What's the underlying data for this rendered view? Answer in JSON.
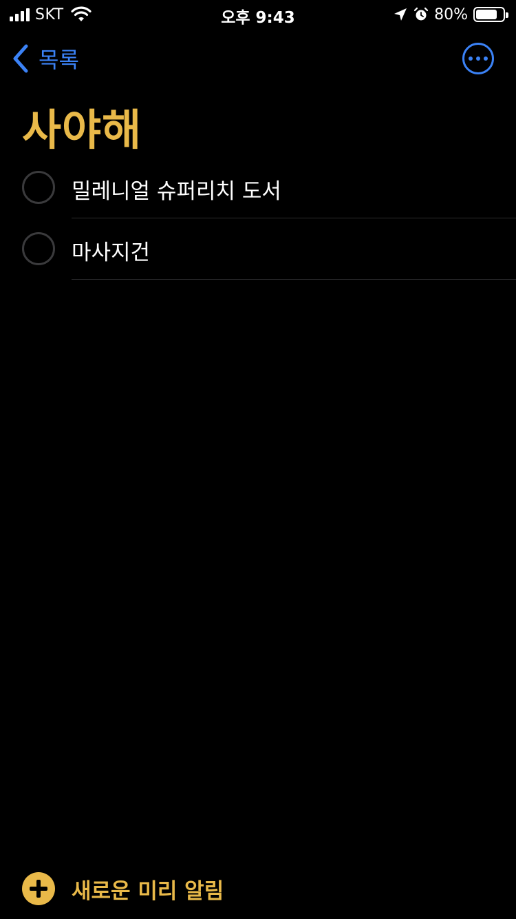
{
  "status_bar": {
    "carrier": "SKT",
    "time": "오후 9:43",
    "battery_percent": "80%",
    "battery_level": 0.8,
    "icons": [
      "signal-icon",
      "wifi-icon",
      "location-arrow-icon",
      "alarm-clock-icon",
      "battery-icon"
    ]
  },
  "nav": {
    "back_label": "목록",
    "more_icon": "ellipsis-circle-icon"
  },
  "list": {
    "title": "사야해",
    "items": [
      {
        "label": "밀레니얼 슈퍼리치 도서",
        "completed": false
      },
      {
        "label": "마사지건",
        "completed": false
      }
    ]
  },
  "footer": {
    "new_reminder_label": "새로운 미리 알림"
  },
  "colors": {
    "accent": "#e9b949",
    "link": "#3b82f6",
    "background": "#000000",
    "divider": "#2c2c2e"
  }
}
